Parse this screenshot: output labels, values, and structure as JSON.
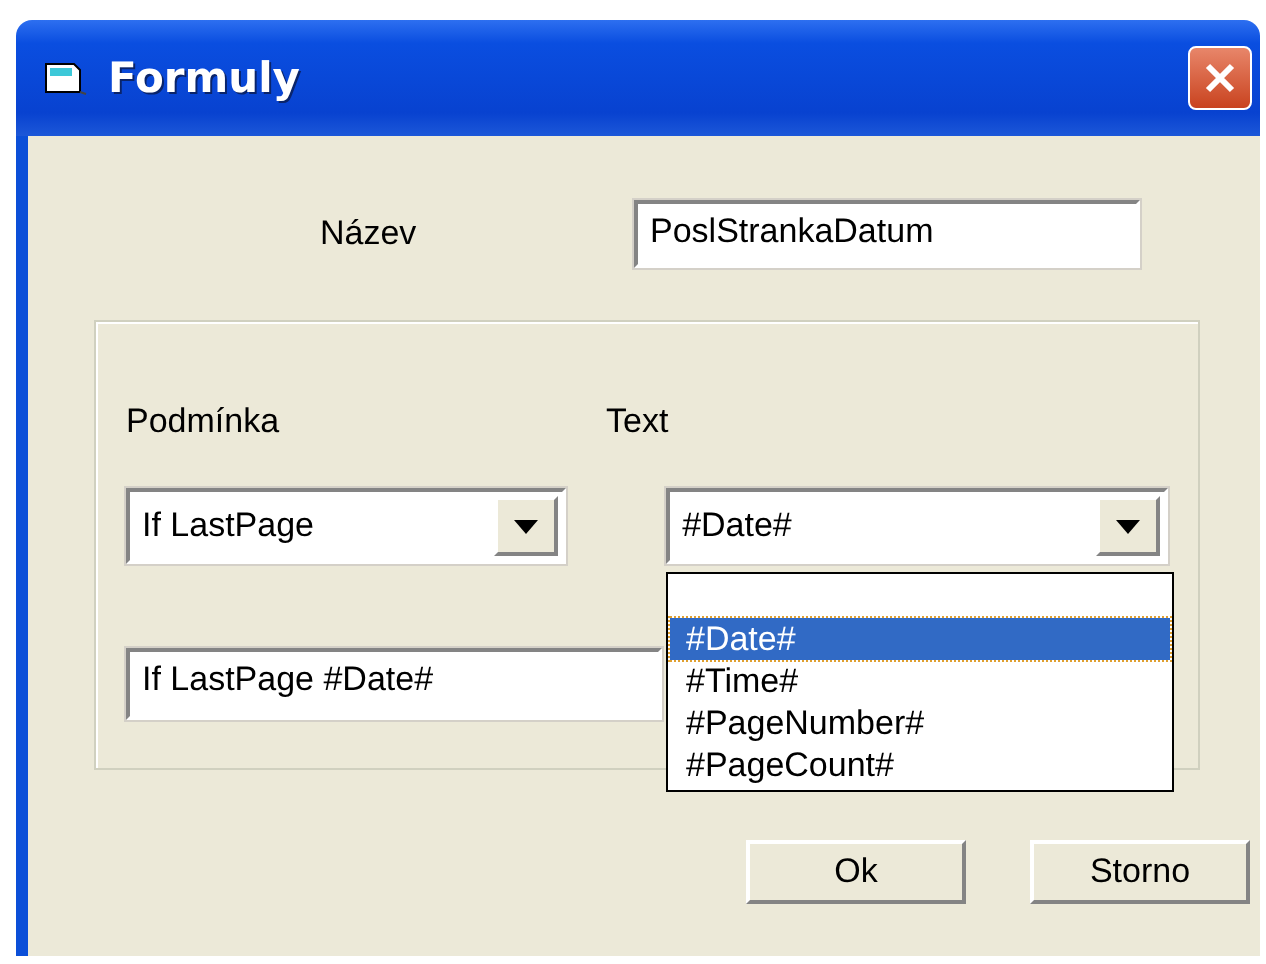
{
  "window": {
    "title": "Formuly"
  },
  "name": {
    "label": "Název",
    "value": "PoslStrankaDatum"
  },
  "condition": {
    "label": "Podmínka",
    "value": "If LastPage"
  },
  "text": {
    "label": "Text",
    "value": "#Date#",
    "expanded": true,
    "options": [
      {
        "label": "#Date#",
        "selected": true
      },
      {
        "label": "#Time#",
        "selected": false
      },
      {
        "label": "#PageNumber#",
        "selected": false
      },
      {
        "label": "#PageCount#",
        "selected": false
      }
    ]
  },
  "result": {
    "value": "If LastPage #Date#"
  },
  "buttons": [
    {
      "label": "Ok"
    },
    {
      "label": "Storno"
    }
  ]
}
